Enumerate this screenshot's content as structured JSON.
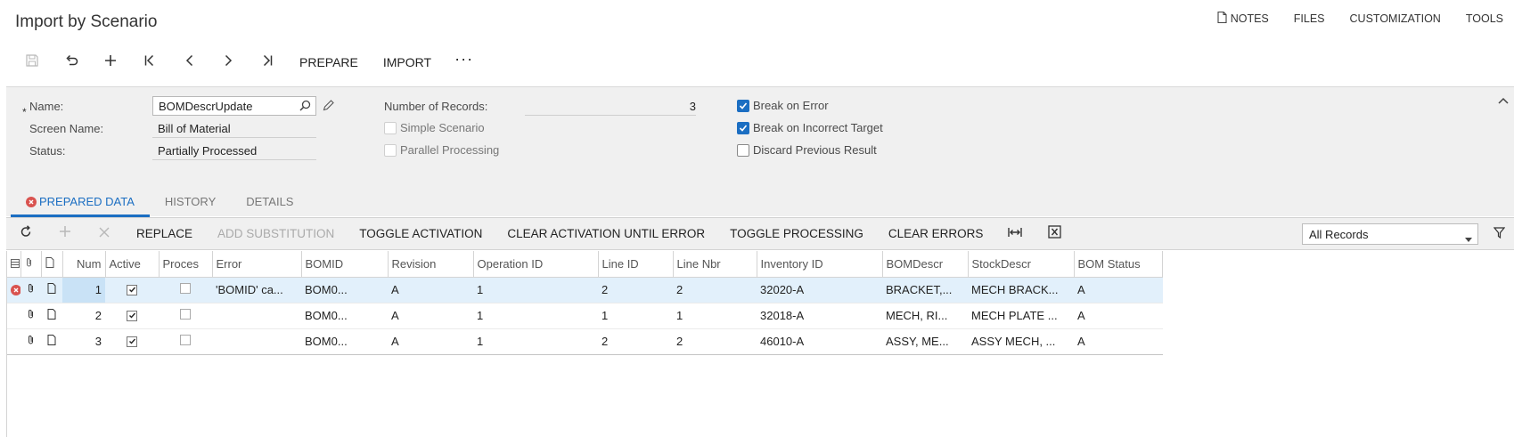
{
  "page": {
    "title": "Import by Scenario"
  },
  "top_links": {
    "notes": "NOTES",
    "files": "FILES",
    "customization": "CUSTOMIZATION",
    "tools": "TOOLS"
  },
  "toolbar": {
    "prepare": "PREPARE",
    "import": "IMPORT",
    "more": "···"
  },
  "form": {
    "required_mark": "*",
    "name_label": "Name:",
    "name_value": "BOMDescrUpdate",
    "screen_name_label": "Screen Name:",
    "screen_name_value": "Bill of Material",
    "status_label": "Status:",
    "status_value": "Partially Processed",
    "num_records_label": "Number of Records:",
    "num_records_value": "3",
    "simple_scenario_label": "Simple Scenario",
    "simple_scenario_checked": false,
    "parallel_processing_label": "Parallel Processing",
    "parallel_processing_checked": false,
    "break_on_error_label": "Break on Error",
    "break_on_error_checked": true,
    "break_on_incorrect_target_label": "Break on Incorrect Target",
    "break_on_incorrect_target_checked": true,
    "discard_previous_result_label": "Discard Previous Result",
    "discard_previous_result_checked": false
  },
  "tabs": [
    {
      "label": "PREPARED DATA",
      "active": true,
      "has_error": true
    },
    {
      "label": "HISTORY",
      "active": false
    },
    {
      "label": "DETAILS",
      "active": false
    }
  ],
  "grid_toolbar": {
    "replace": "REPLACE",
    "add_substitution": "ADD SUBSTITUTION",
    "toggle_activation": "TOGGLE ACTIVATION",
    "clear_activation_until_error": "CLEAR ACTIVATION UNTIL ERROR",
    "toggle_processing": "TOGGLE PROCESSING",
    "clear_errors": "CLEAR ERRORS",
    "filter_value": "All Records"
  },
  "grid": {
    "columns": [
      "Num",
      "Active",
      "Proces",
      "Error",
      "BOMID",
      "Revision",
      "Operation ID",
      "Line ID",
      "Line Nbr",
      "Inventory ID",
      "BOMDescr",
      "StockDescr",
      "BOM Status"
    ],
    "rows": [
      {
        "has_error": true,
        "num": "1",
        "active": true,
        "processed": false,
        "error": "'BOMID' ca...",
        "bomid": "BOM0...",
        "revision": "A",
        "operation_id": "1",
        "line_id": "2",
        "line_nbr": "2",
        "inventory_id": "32020-A",
        "bomdescr": "BRACKET,...",
        "stockdescr": "MECH BRACK...",
        "bom_status": "A"
      },
      {
        "has_error": false,
        "num": "2",
        "active": true,
        "processed": false,
        "error": "",
        "bomid": "BOM0...",
        "revision": "A",
        "operation_id": "1",
        "line_id": "1",
        "line_nbr": "1",
        "inventory_id": "32018-A",
        "bomdescr": "MECH, RI...",
        "stockdescr": "MECH PLATE ...",
        "bom_status": "A"
      },
      {
        "has_error": false,
        "num": "3",
        "active": true,
        "processed": false,
        "error": "",
        "bomid": "BOM0...",
        "revision": "A",
        "operation_id": "1",
        "line_id": "2",
        "line_nbr": "2",
        "inventory_id": "46010-A",
        "bomdescr": "ASSY, ME...",
        "stockdescr": "ASSY MECH, ...",
        "bom_status": "A"
      }
    ]
  },
  "colors": {
    "accent": "#1b6ec2",
    "error": "#d9534f",
    "panel": "#f0f0f0",
    "selected_row": "#e2f0fb"
  }
}
